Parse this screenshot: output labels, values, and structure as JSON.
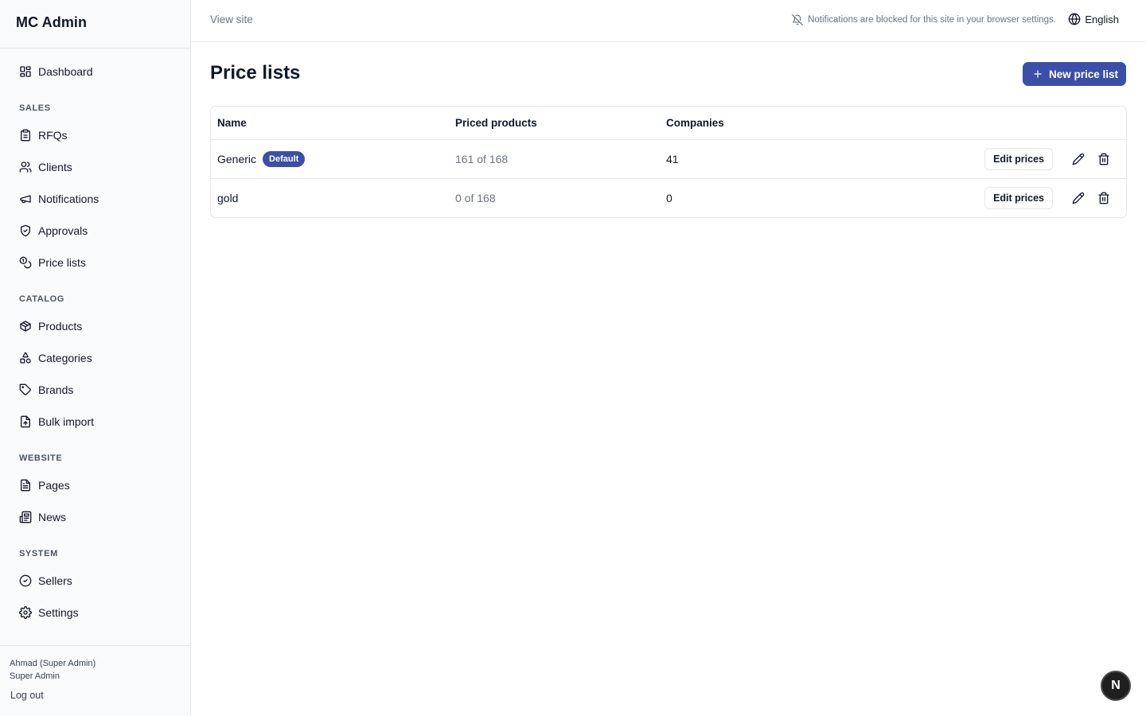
{
  "app": {
    "brand": "MC Admin"
  },
  "sidebar": {
    "top_item": {
      "label": "Dashboard",
      "icon": "dashboard-icon"
    },
    "sections": [
      {
        "label": "SALES",
        "items": [
          {
            "label": "RFQs",
            "icon": "clipboard-icon"
          },
          {
            "label": "Clients",
            "icon": "users-icon"
          },
          {
            "label": "Notifications",
            "icon": "megaphone-icon"
          },
          {
            "label": "Approvals",
            "icon": "shield-check-icon"
          },
          {
            "label": "Price lists",
            "icon": "coins-icon"
          }
        ]
      },
      {
        "label": "CATALOG",
        "items": [
          {
            "label": "Products",
            "icon": "package-icon"
          },
          {
            "label": "Categories",
            "icon": "shapes-icon"
          },
          {
            "label": "Brands",
            "icon": "tag-icon"
          },
          {
            "label": "Bulk import",
            "icon": "file-upload-icon"
          }
        ]
      },
      {
        "label": "WEBSITE",
        "items": [
          {
            "label": "Pages",
            "icon": "file-text-icon"
          },
          {
            "label": "News",
            "icon": "newspaper-icon"
          }
        ]
      },
      {
        "label": "SYSTEM",
        "items": [
          {
            "label": "Sellers",
            "icon": "badge-check-icon"
          },
          {
            "label": "Settings",
            "icon": "gear-icon"
          }
        ]
      }
    ],
    "footer": {
      "user_name": "Ahmad (Super Admin)",
      "user_role": "Super Admin",
      "logout_label": "Log out"
    }
  },
  "topbar": {
    "view_site": "View site",
    "notification_message": "Notifications are blocked for this site in your browser settings.",
    "language": "English"
  },
  "main": {
    "title": "Price lists",
    "new_button": "New price list",
    "table": {
      "columns": [
        "Name",
        "Priced products",
        "Companies"
      ],
      "rows": [
        {
          "name": "Generic",
          "badge": "Default",
          "priced": "161 of 168",
          "companies": "41",
          "edit_label": "Edit prices"
        },
        {
          "name": "gold",
          "badge": "",
          "priced": "0 of 168",
          "companies": "0",
          "edit_label": "Edit prices"
        }
      ]
    }
  },
  "fab": {
    "label": "N"
  },
  "colors": {
    "accent": "#3b4fa8",
    "border": "#e5e7eb",
    "sidebar_bg": "#f9fafc"
  }
}
